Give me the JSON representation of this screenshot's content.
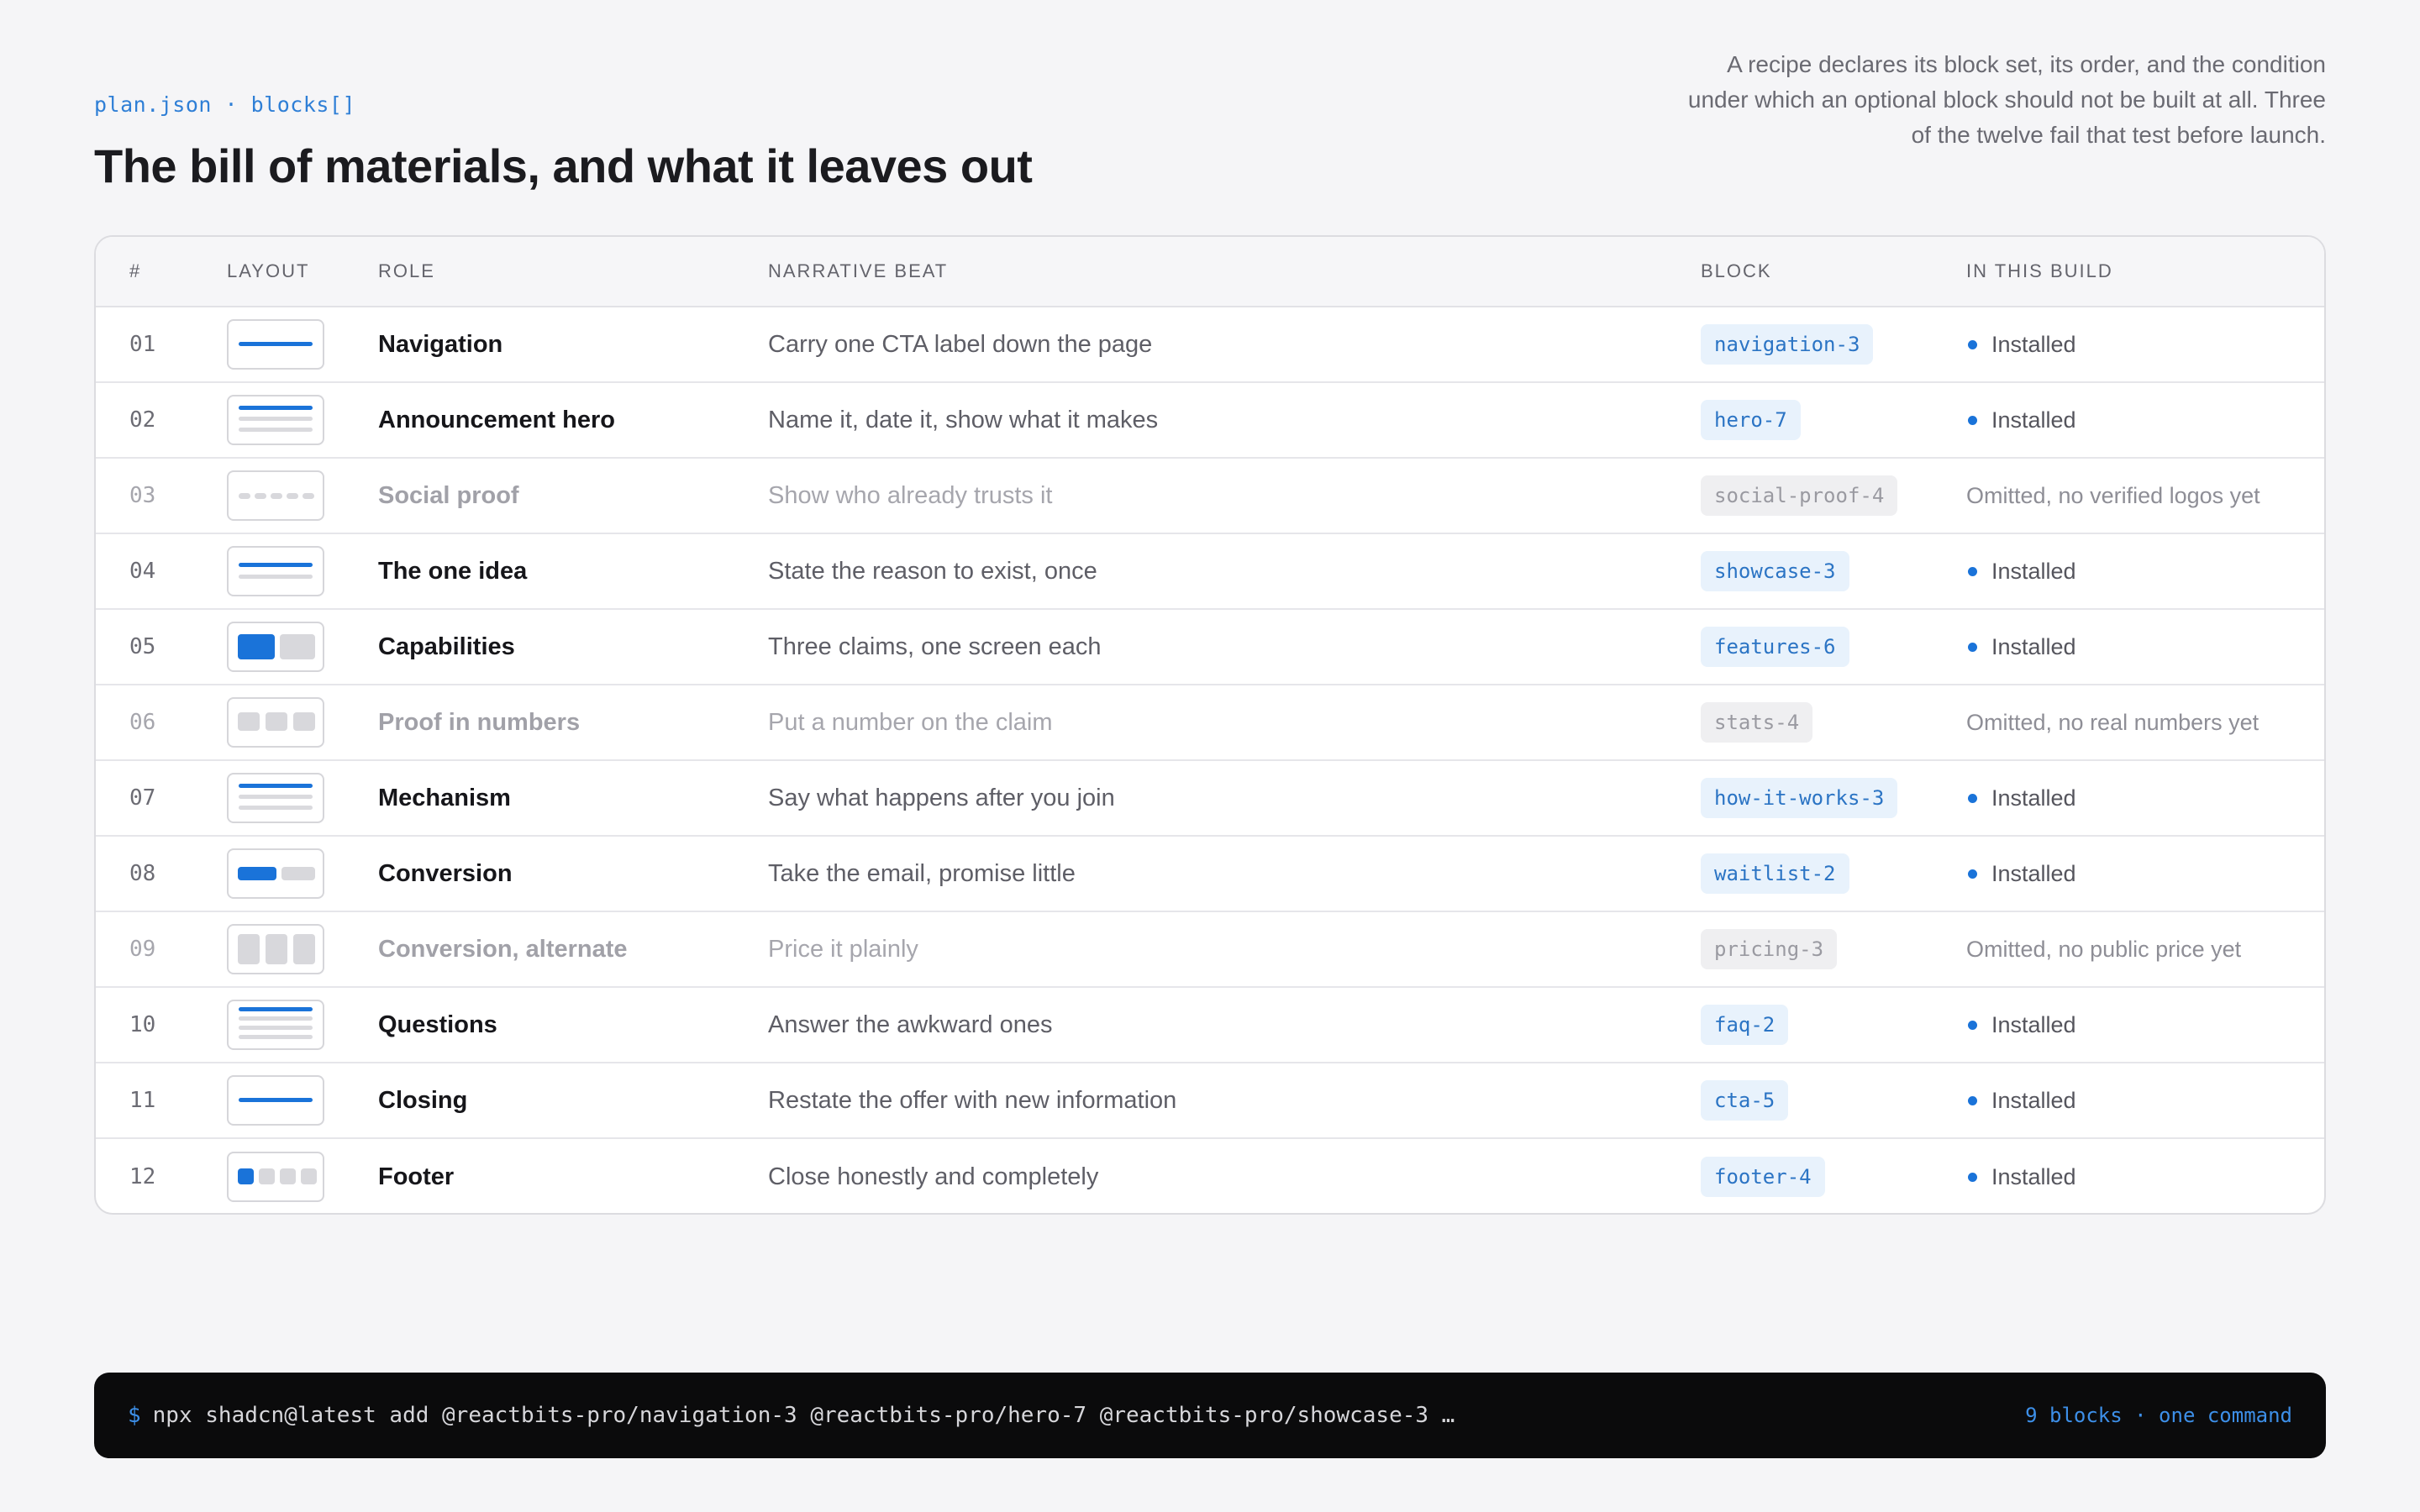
{
  "header": {
    "eyebrow": "plan.json · blocks[]",
    "title": "The bill of materials, and what it leaves out",
    "description": "A recipe declares its block set, its order, and the condition under which an optional block should not be built at all. Three of the twelve fail that test before launch."
  },
  "table": {
    "columns": [
      "#",
      "LAYOUT",
      "ROLE",
      "NARRATIVE BEAT",
      "BLOCK",
      "IN THIS BUILD"
    ],
    "rows": [
      {
        "num": "01",
        "role": "Navigation",
        "beat": "Carry one CTA label down the page",
        "block": "navigation-3",
        "status": "Installed",
        "included": true,
        "layout": "nav-line-icon"
      },
      {
        "num": "02",
        "role": "Announcement hero",
        "beat": "Name it, date it, show what it makes",
        "block": "hero-7",
        "status": "Installed",
        "included": true,
        "layout": "hero-lines-icon"
      },
      {
        "num": "03",
        "role": "Social proof",
        "beat": "Show who already trusts it",
        "block": "social-proof-4",
        "status": "Omitted, no verified logos yet",
        "included": false,
        "layout": "logo-dots-icon"
      },
      {
        "num": "04",
        "role": "The one idea",
        "beat": "State the reason to exist, once",
        "block": "showcase-3",
        "status": "Installed",
        "included": true,
        "layout": "showcase-lines-icon"
      },
      {
        "num": "05",
        "role": "Capabilities",
        "beat": "Three claims, one screen each",
        "block": "features-6",
        "status": "Installed",
        "included": true,
        "layout": "features-split-icon"
      },
      {
        "num": "06",
        "role": "Proof in numbers",
        "beat": "Put a number on the claim",
        "block": "stats-4",
        "status": "Omitted, no real numbers yet",
        "included": false,
        "layout": "stats-tiles-icon"
      },
      {
        "num": "07",
        "role": "Mechanism",
        "beat": "Say what happens after you join",
        "block": "how-it-works-3",
        "status": "Installed",
        "included": true,
        "layout": "steps-lines-icon"
      },
      {
        "num": "08",
        "role": "Conversion",
        "beat": "Take the email, promise little",
        "block": "waitlist-2",
        "status": "Installed",
        "included": true,
        "layout": "input-button-icon"
      },
      {
        "num": "09",
        "role": "Conversion, alternate",
        "beat": "Price it plainly",
        "block": "pricing-3",
        "status": "Omitted, no public price yet",
        "included": false,
        "layout": "pricing-cards-icon"
      },
      {
        "num": "10",
        "role": "Questions",
        "beat": "Answer the awkward ones",
        "block": "faq-2",
        "status": "Installed",
        "included": true,
        "layout": "faq-lines-icon"
      },
      {
        "num": "11",
        "role": "Closing",
        "beat": "Restate the offer with new information",
        "block": "cta-5",
        "status": "Installed",
        "included": true,
        "layout": "cta-line-icon"
      },
      {
        "num": "12",
        "role": "Footer",
        "beat": "Close honestly and completely",
        "block": "footer-4",
        "status": "Installed",
        "included": true,
        "layout": "footer-squares-icon"
      }
    ]
  },
  "command": {
    "prompt": "$",
    "text": "npx shadcn@latest add @reactbits-pro/navigation-3 @reactbits-pro/hero-7 @reactbits-pro/showcase-3 …",
    "note": "9 blocks · one command"
  },
  "colors": {
    "accent": "#1a73d9",
    "chip_bg": "#e8f2fc",
    "terminal_bg": "#0b0b0c"
  }
}
